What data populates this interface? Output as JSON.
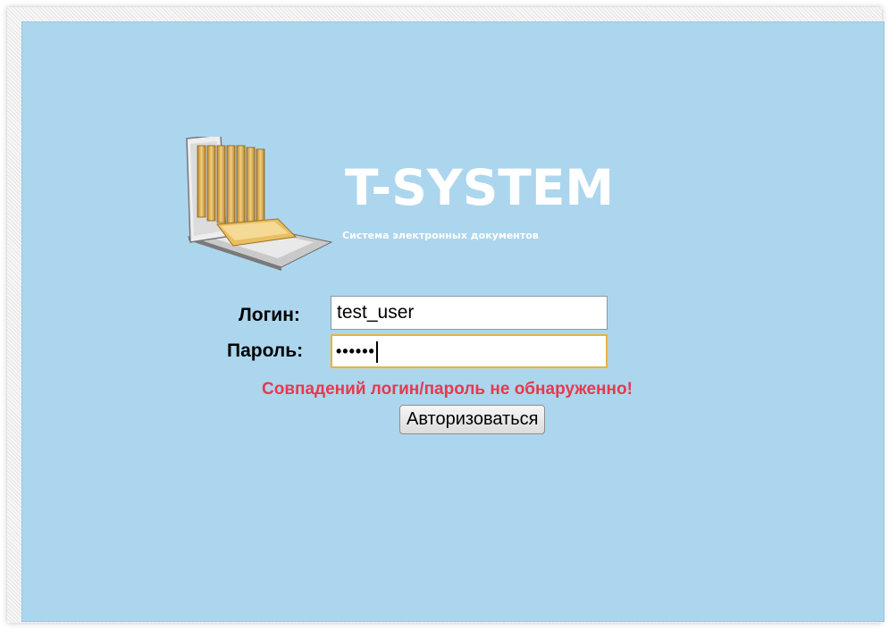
{
  "brand": {
    "title": "T-SYSTEM",
    "subtitle": "Система электронных документов",
    "logo_icon": "laptop-folders-icon"
  },
  "form": {
    "login_label": "Логин:",
    "login_value": "test_user",
    "password_label": "Пароль:",
    "password_mask": "••••••",
    "error_message": "Совпадений логин/пароль не обнаруженно!",
    "submit_label": "Авторизоваться"
  },
  "colors": {
    "background": "#acd6ee",
    "error": "#e8384f",
    "focus_border": "#e3b34b"
  }
}
